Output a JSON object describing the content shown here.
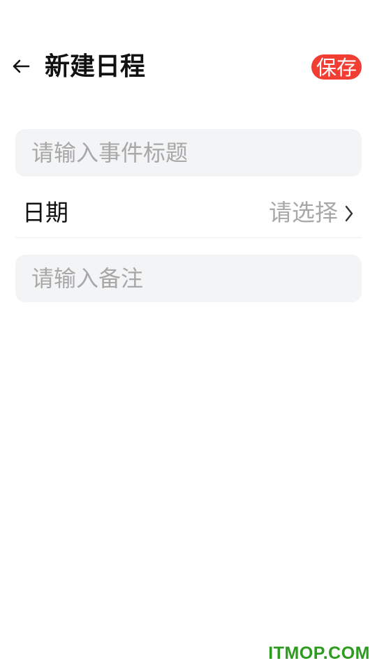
{
  "header": {
    "title": "新建日程",
    "save_label": "保存",
    "back_icon": "arrow-left-icon"
  },
  "form": {
    "title_placeholder": "请输入事件标题",
    "date_label": "日期",
    "date_value": "请选择",
    "date_chevron_icon": "chevron-right-icon",
    "note_placeholder": "请输入备注"
  },
  "watermark": "ITMOP.COM",
  "colors": {
    "accent": "#f23d32",
    "field_bg": "#f3f4f6",
    "placeholder": "#a8a8a8",
    "watermark": "#2e9a1f"
  }
}
